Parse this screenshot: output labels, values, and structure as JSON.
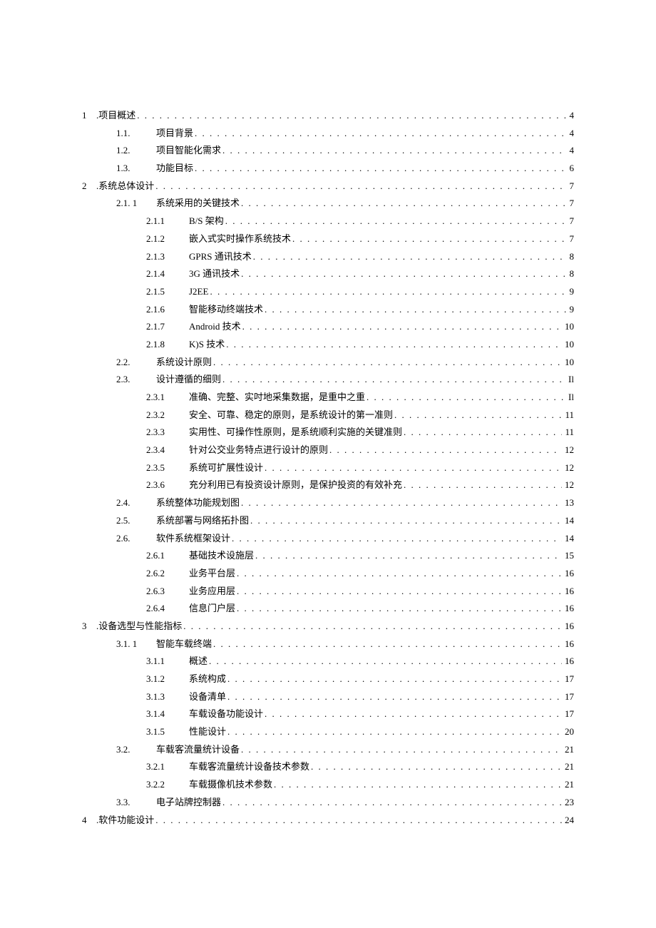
{
  "toc": [
    {
      "level": 0,
      "num": "1",
      "title": ".项目概述",
      "page": "4"
    },
    {
      "level": 1,
      "num": "1.1.",
      "title": "项目背景",
      "page": "4"
    },
    {
      "level": 1,
      "num": "1.2.",
      "title": "项目智能化需求",
      "page": "4"
    },
    {
      "level": 1,
      "num": "1.3.",
      "title": "功能目标",
      "page": "6"
    },
    {
      "level": 0,
      "num": "2",
      "title": ".系统总体设计",
      "page": "7"
    },
    {
      "level": 1,
      "num": "2.1. 1",
      "title": "系统采用的关键技术",
      "page": "7"
    },
    {
      "level": 2,
      "num": "2.1.1",
      "title": "B/S 架构",
      "page": "7"
    },
    {
      "level": 2,
      "num": "2.1.2",
      "title": "嵌入式实时操作系统技术",
      "page": "7"
    },
    {
      "level": 2,
      "num": "2.1.3",
      "title": "GPRS 通讯技术",
      "page": "8"
    },
    {
      "level": 2,
      "num": "2.1.4",
      "title": "3G 通讯技术",
      "page": "8"
    },
    {
      "level": 2,
      "num": "2.1.5",
      "title": "J2EE",
      "page": "9"
    },
    {
      "level": 2,
      "num": "2.1.6",
      "title": "智能移动终端技术",
      "page": "9"
    },
    {
      "level": 2,
      "num": "2.1.7",
      "title": "Android 技术",
      "page": "10"
    },
    {
      "level": 2,
      "num": "2.1.8",
      "title": "K)S 技术",
      "page": "10"
    },
    {
      "level": 1,
      "num": "2.2.",
      "title": "系统设计原则",
      "page": "10"
    },
    {
      "level": 1,
      "num": "2.3.",
      "title": "设计遵循的细则",
      "page": "Il"
    },
    {
      "level": 2,
      "num": "2.3.1",
      "title": "准确、完整、实吋地采集数据，是重中之重",
      "page": "Il"
    },
    {
      "level": 2,
      "num": "2.3.2",
      "title": "安全、可靠、稳定的原则，是系统设计的第一准则",
      "page": "11"
    },
    {
      "level": 2,
      "num": "2.3.3",
      "title": "实用性、可操作性原则，是系统顺利实施的关键准则",
      "page": "11"
    },
    {
      "level": 2,
      "num": "2.3.4",
      "title": "针对公交业务特点进行设计的原则",
      "page": "12"
    },
    {
      "level": 2,
      "num": "2.3.5",
      "title": "系统可扩展性设计",
      "page": "12"
    },
    {
      "level": 2,
      "num": "2.3.6",
      "title": "充分利用已有投资设计原则，是保护投资的有效补充",
      "page": "12"
    },
    {
      "level": 1,
      "num": "2.4.",
      "title": "系统整体功能规划图",
      "page": "13"
    },
    {
      "level": 1,
      "num": "2.5.",
      "title": "系统部署与网络拓扑图",
      "page": "14"
    },
    {
      "level": 1,
      "num": "2.6.",
      "title": "软件系统框架设计",
      "page": "14"
    },
    {
      "level": 2,
      "num": "2.6.1",
      "title": "基础技术设施层",
      "page": "15"
    },
    {
      "level": 2,
      "num": "2.6.2",
      "title": "业务平台层",
      "page": "16"
    },
    {
      "level": 2,
      "num": "2.6.3",
      "title": "业务应用层",
      "page": "16"
    },
    {
      "level": 2,
      "num": "2.6.4",
      "title": "信息门户层",
      "page": "16"
    },
    {
      "level": 0,
      "num": "3",
      "title": ".设备选型与性能指标",
      "page": "16"
    },
    {
      "level": 1,
      "num": "3.1. 1",
      "title": "智能车载终端",
      "page": "16"
    },
    {
      "level": 2,
      "num": "3.1.1",
      "title": "概述",
      "page": "16"
    },
    {
      "level": 2,
      "num": "3.1.2",
      "title": "系统构成",
      "page": "17"
    },
    {
      "level": 2,
      "num": "3.1.3",
      "title": "设备清单",
      "page": "17"
    },
    {
      "level": 2,
      "num": "3.1.4",
      "title": "车载设备功能设计",
      "page": "17"
    },
    {
      "level": 2,
      "num": "3.1.5",
      "title": "性能设计",
      "page": "20"
    },
    {
      "level": 1,
      "num": "3.2.",
      "title": "车载客流量统计设备",
      "page": "21"
    },
    {
      "level": 2,
      "num": "3.2.1",
      "title": "车载客流量统计设备技术参数",
      "page": "21"
    },
    {
      "level": 2,
      "num": "3.2.2",
      "title": "车载摄像机技术参数",
      "page": "21"
    },
    {
      "level": 1,
      "num": "3.3.",
      "title": "电子站牌控制器",
      "page": "23"
    },
    {
      "level": 0,
      "num": "4",
      "title": ".软件功能设计",
      "page": "24"
    }
  ]
}
